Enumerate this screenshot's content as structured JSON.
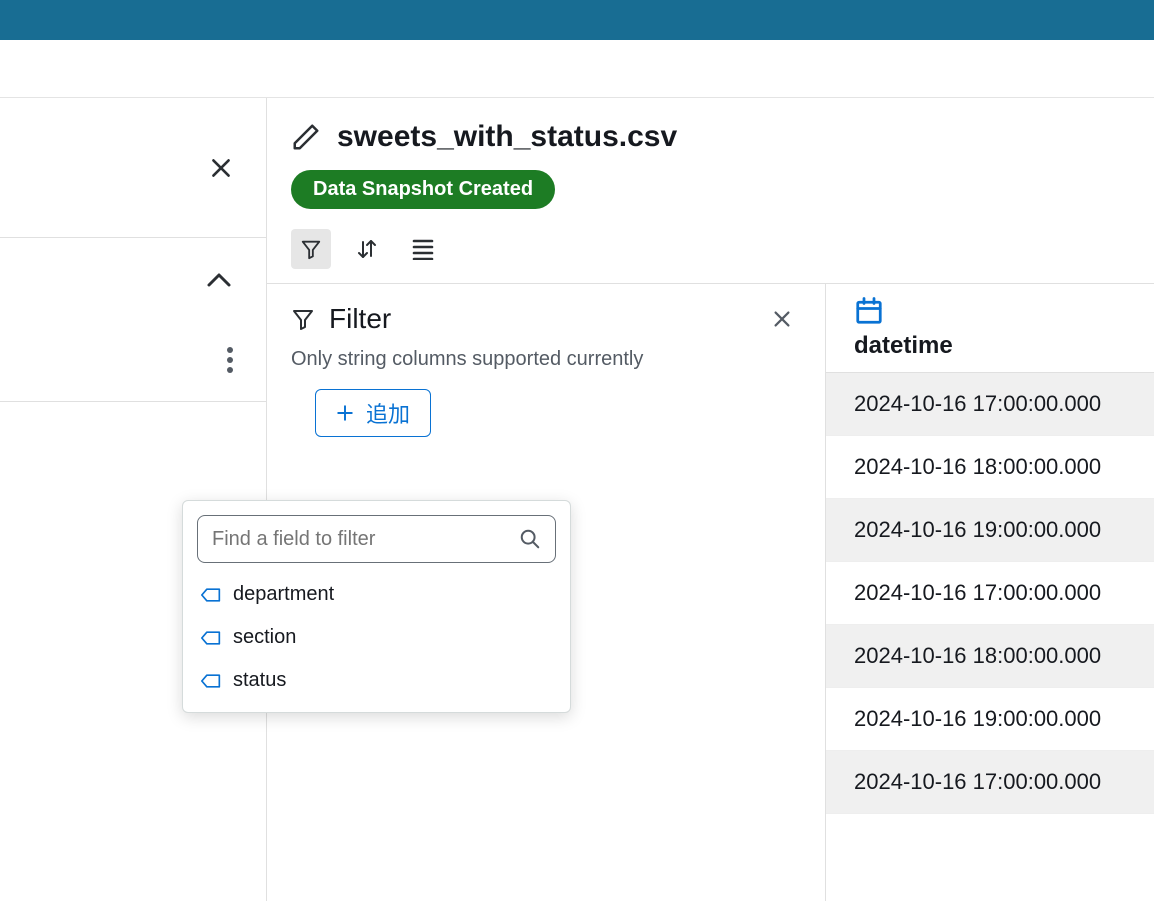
{
  "file": {
    "name": "sweets_with_status.csv"
  },
  "status": {
    "badge": "Data Snapshot Created"
  },
  "filter": {
    "title": "Filter",
    "description": "Only string columns supported currently",
    "add_label": "追加",
    "search_placeholder": "Find a field to filter",
    "fields": [
      {
        "name": "department"
      },
      {
        "name": "section"
      },
      {
        "name": "status"
      }
    ]
  },
  "table": {
    "column": {
      "name": "datetime",
      "type": "datetime"
    },
    "rows": [
      "2024-10-16 17:00:00.000",
      "2024-10-16 18:00:00.000",
      "2024-10-16 19:00:00.000",
      "2024-10-16 17:00:00.000",
      "2024-10-16 18:00:00.000",
      "2024-10-16 19:00:00.000",
      "2024-10-16 17:00:00.000"
    ]
  },
  "icons": {
    "close": "close-icon",
    "chevron_up": "chevron-up-icon",
    "more": "more-vertical-icon",
    "pencil": "pencil-icon",
    "filter": "filter-icon",
    "sort": "sort-icon",
    "rows": "rows-icon",
    "calendar": "calendar-icon",
    "plus": "plus-icon",
    "search": "search-icon",
    "tag": "tag-icon"
  }
}
